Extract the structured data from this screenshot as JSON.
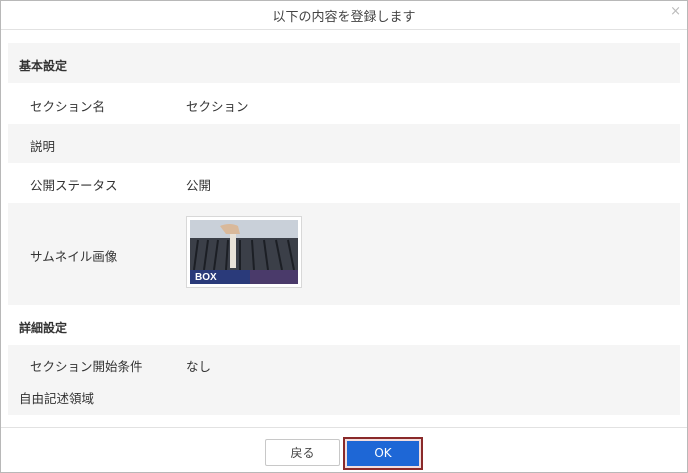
{
  "dialog": {
    "title": "以下の内容を登録します",
    "close_icon": "×"
  },
  "basic_settings": {
    "header": "基本設定",
    "section_name_label": "セクション名",
    "section_name_value": "セクション",
    "description_label": "説明",
    "description_value": "",
    "status_label": "公開ステータス",
    "status_value": "公開",
    "thumbnail_label": "サムネイル画像",
    "thumbnail_caption": "BOX"
  },
  "advanced_settings": {
    "header": "詳細設定",
    "start_condition_label": "セクション開始条件",
    "start_condition_value": "なし",
    "free_text_label": "自由記述領域"
  },
  "footer": {
    "back_label": "戻る",
    "ok_label": "OK"
  },
  "colors": {
    "ok_button": "#1e67d6",
    "ok_highlight_border": "#8a2a2a",
    "row_background": "#f5f5f5"
  },
  "icons": {
    "close": "close-icon",
    "thumbnail": "file-cabinet-photo"
  }
}
